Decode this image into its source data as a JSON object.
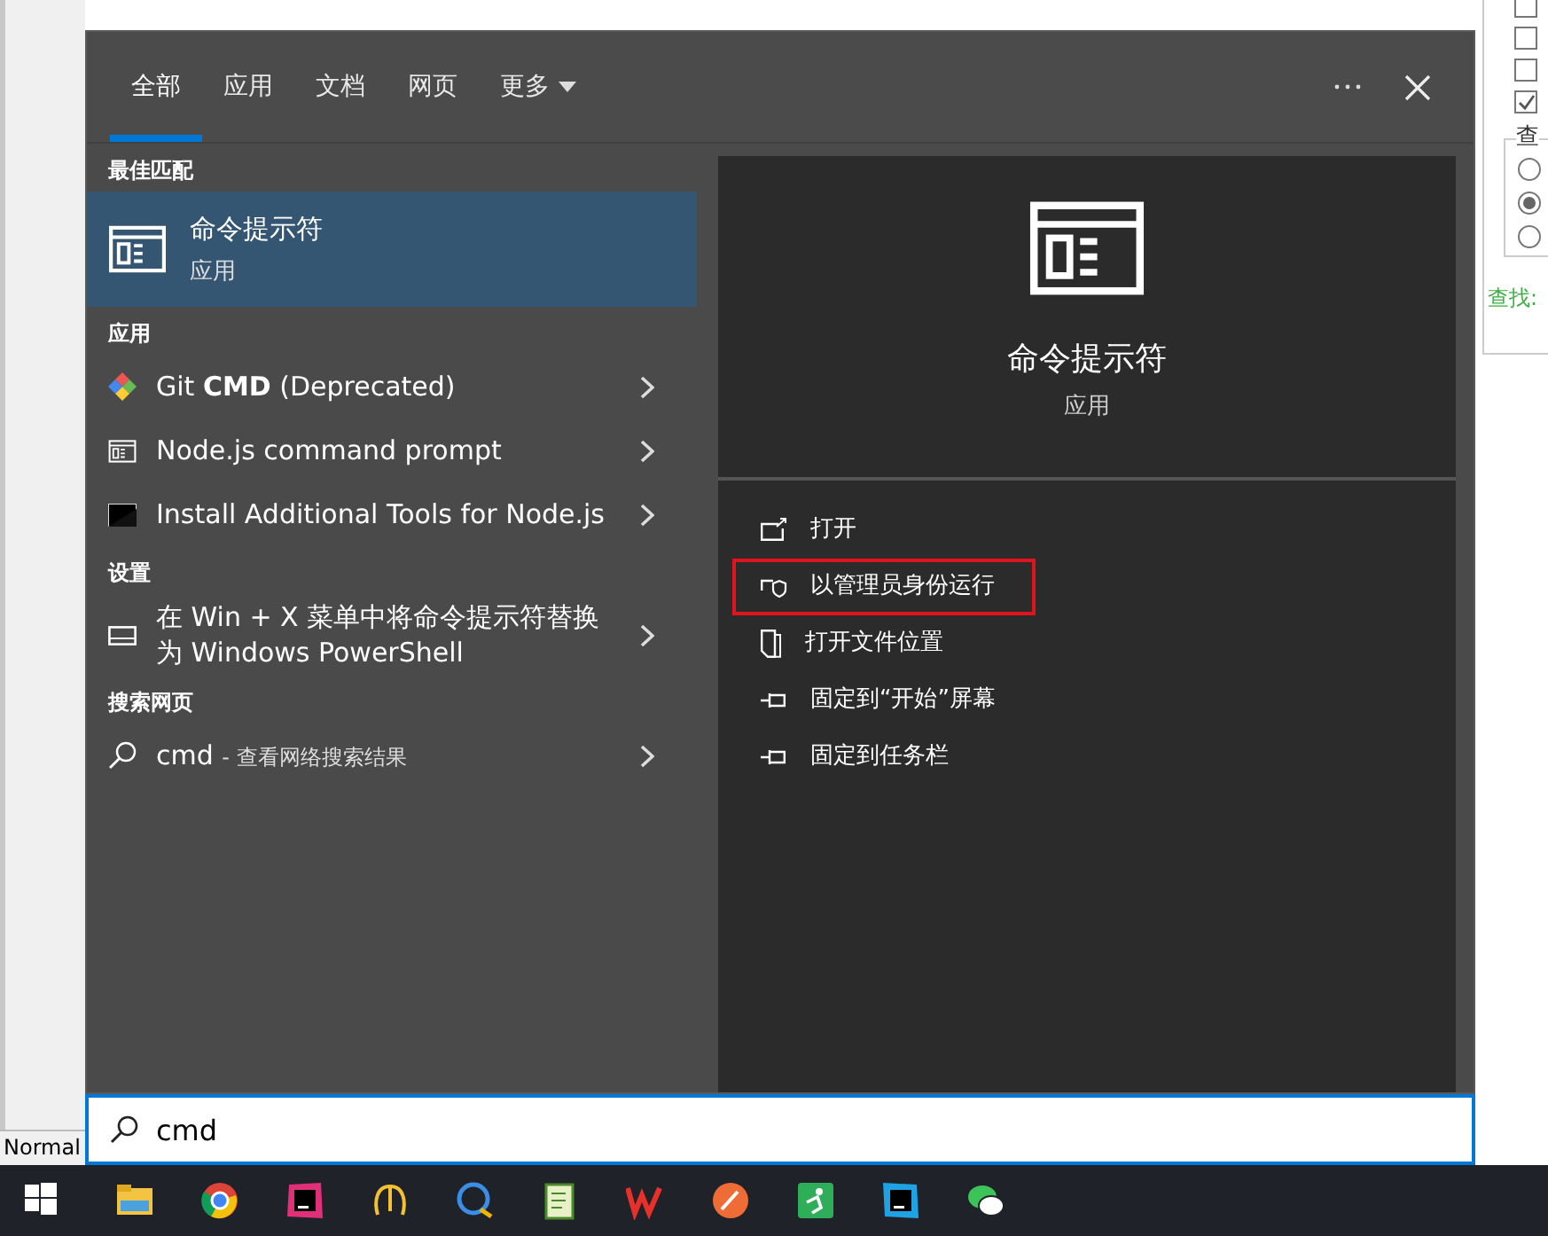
{
  "background_app": {
    "checkboxes": [
      {
        "checked": false
      },
      {
        "checked": false
      },
      {
        "checked": false
      },
      {
        "checked": true
      }
    ],
    "group_label": "查",
    "radios": [
      {
        "selected": false
      },
      {
        "selected": true
      },
      {
        "selected": false
      }
    ],
    "find_label": "查找:",
    "status_text": "Normal"
  },
  "search_panel": {
    "tabs": [
      {
        "label": "全部",
        "selected": true,
        "kind": "tab"
      },
      {
        "label": "应用",
        "selected": false,
        "kind": "tab"
      },
      {
        "label": "文档",
        "selected": false,
        "kind": "tab"
      },
      {
        "label": "网页",
        "selected": false,
        "kind": "tab"
      },
      {
        "label": "更多",
        "selected": false,
        "kind": "dropdown"
      }
    ],
    "sections": [
      {
        "heading": "最佳匹配",
        "items": [
          {
            "kind": "best",
            "title": "命令提示符",
            "subtitle": "应用",
            "selected": true
          }
        ]
      },
      {
        "heading": "应用",
        "items": [
          {
            "kind": "result",
            "title": "Git **CMD** (Deprecated)",
            "selected": false
          },
          {
            "kind": "result",
            "title": "Node.js command prompt",
            "selected": false
          },
          {
            "kind": "result",
            "title": "Install Additional Tools for Node.js",
            "selected": false
          }
        ]
      },
      {
        "heading": "设置",
        "items": [
          {
            "kind": "result",
            "title": "在 Win + X 菜单中将命令提示符替换为 Windows PowerShell",
            "selected": false
          }
        ]
      },
      {
        "heading": "搜索网页",
        "items": [
          {
            "kind": "web",
            "title": "cmd",
            "suffix": "- 查看网络搜索结果",
            "selected": false
          }
        ]
      }
    ],
    "detail": {
      "title": "命令提示符",
      "subtitle": "应用",
      "actions": [
        {
          "label": "打开",
          "highlighted": false
        },
        {
          "label": "以管理员身份运行",
          "highlighted": true
        },
        {
          "label": "打开文件位置",
          "highlighted": false
        },
        {
          "label": "固定到“开始”屏幕",
          "highlighted": false
        },
        {
          "label": "固定到任务栏",
          "highlighted": false
        }
      ]
    },
    "search_field": {
      "value": "cmd"
    }
  }
}
